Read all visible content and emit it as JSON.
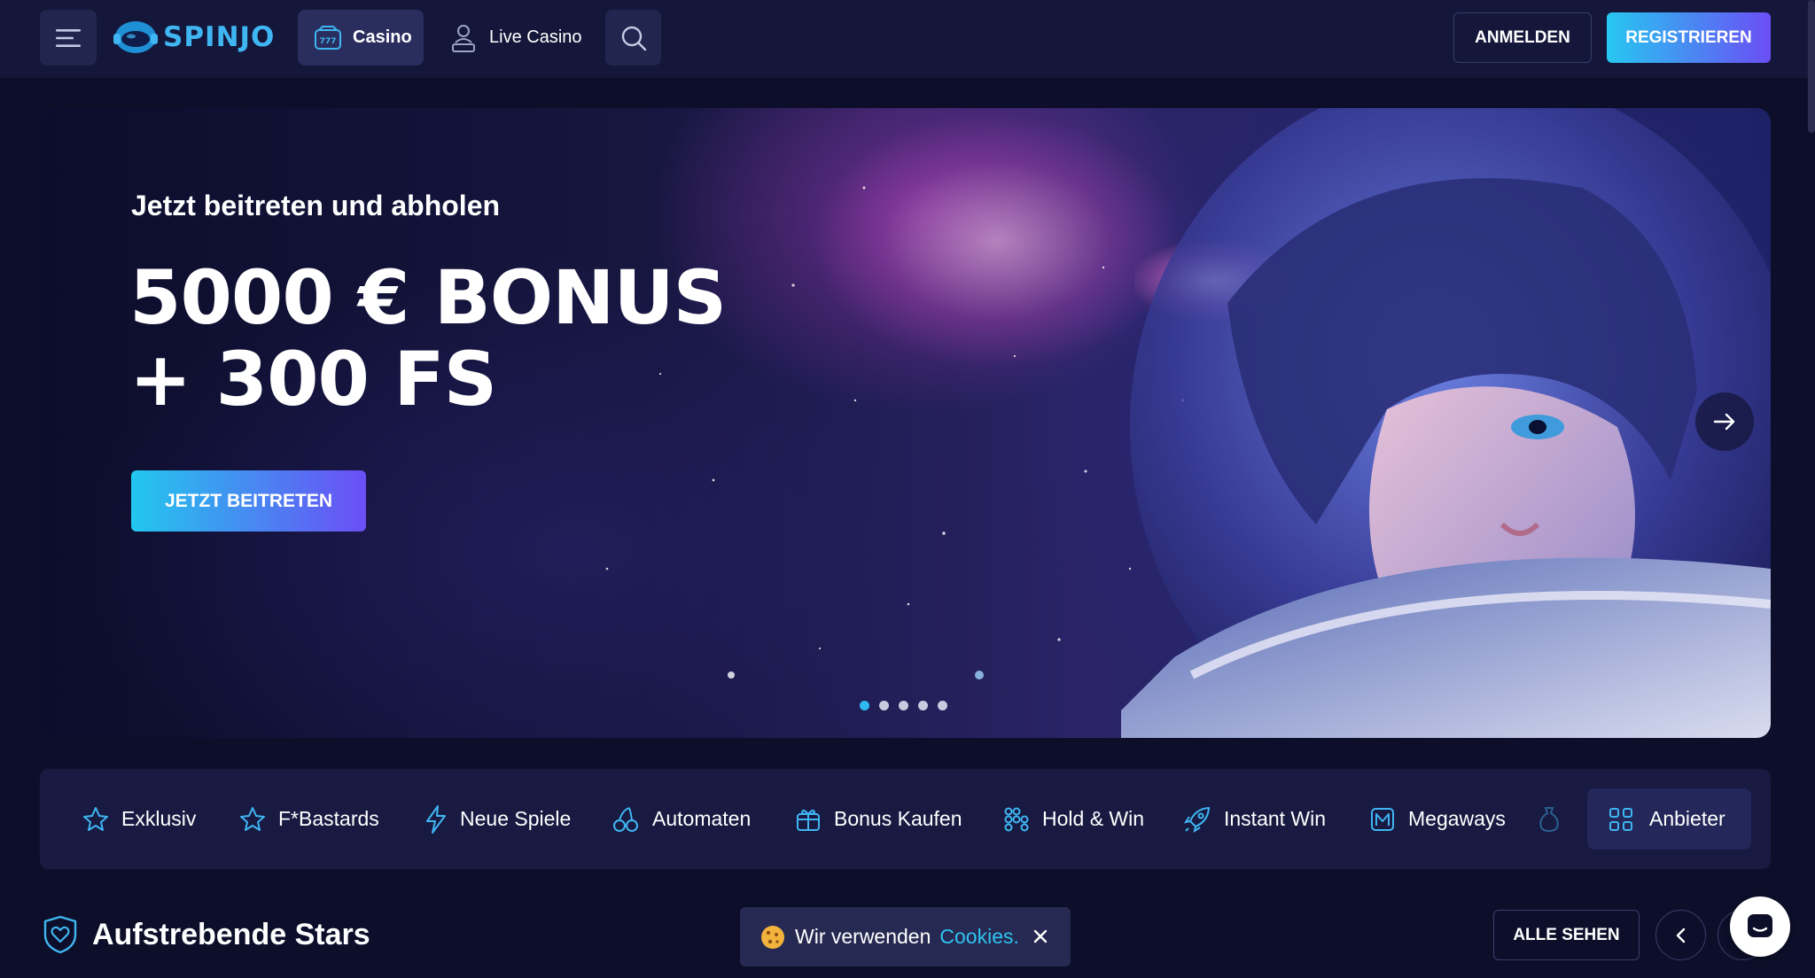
{
  "header": {
    "logo_text": "SPINJO",
    "nav_casino": "Casino",
    "nav_live_casino": "Live Casino",
    "login_label": "ANMELDEN",
    "register_label": "REGISTRIEREN"
  },
  "hero": {
    "kicker": "Jetzt beitreten und abholen",
    "title_line1": "5000 € BONUS",
    "title_line2": "+ 300 FS",
    "cta_label": "JETZT BEITRETEN",
    "slides_total": 5,
    "active_slide": 1
  },
  "categories": [
    {
      "label": "Exklusiv",
      "icon": "star-icon"
    },
    {
      "label": "F*Bastards",
      "icon": "star-icon"
    },
    {
      "label": "Neue Spiele",
      "icon": "lightning-icon"
    },
    {
      "label": "Automaten",
      "icon": "cherries-icon"
    },
    {
      "label": "Bonus Kaufen",
      "icon": "gift-icon"
    },
    {
      "label": "Hold & Win",
      "icon": "dots-grid-icon"
    },
    {
      "label": "Instant Win",
      "icon": "rocket-icon"
    },
    {
      "label": "Megaways",
      "icon": "megaways-icon"
    }
  ],
  "providers_label": "Anbieter",
  "section": {
    "title": "Aufstrebende Stars",
    "see_all_label": "ALLE SEHEN"
  },
  "cookie": {
    "text": "Wir verwenden",
    "link": "Cookies."
  },
  "colors": {
    "background": "#0d0f2a",
    "header": "#14163a",
    "accent_cyan": "#27c7f0",
    "accent_purple": "#6b4ef5",
    "category_bar": "#181a42"
  }
}
